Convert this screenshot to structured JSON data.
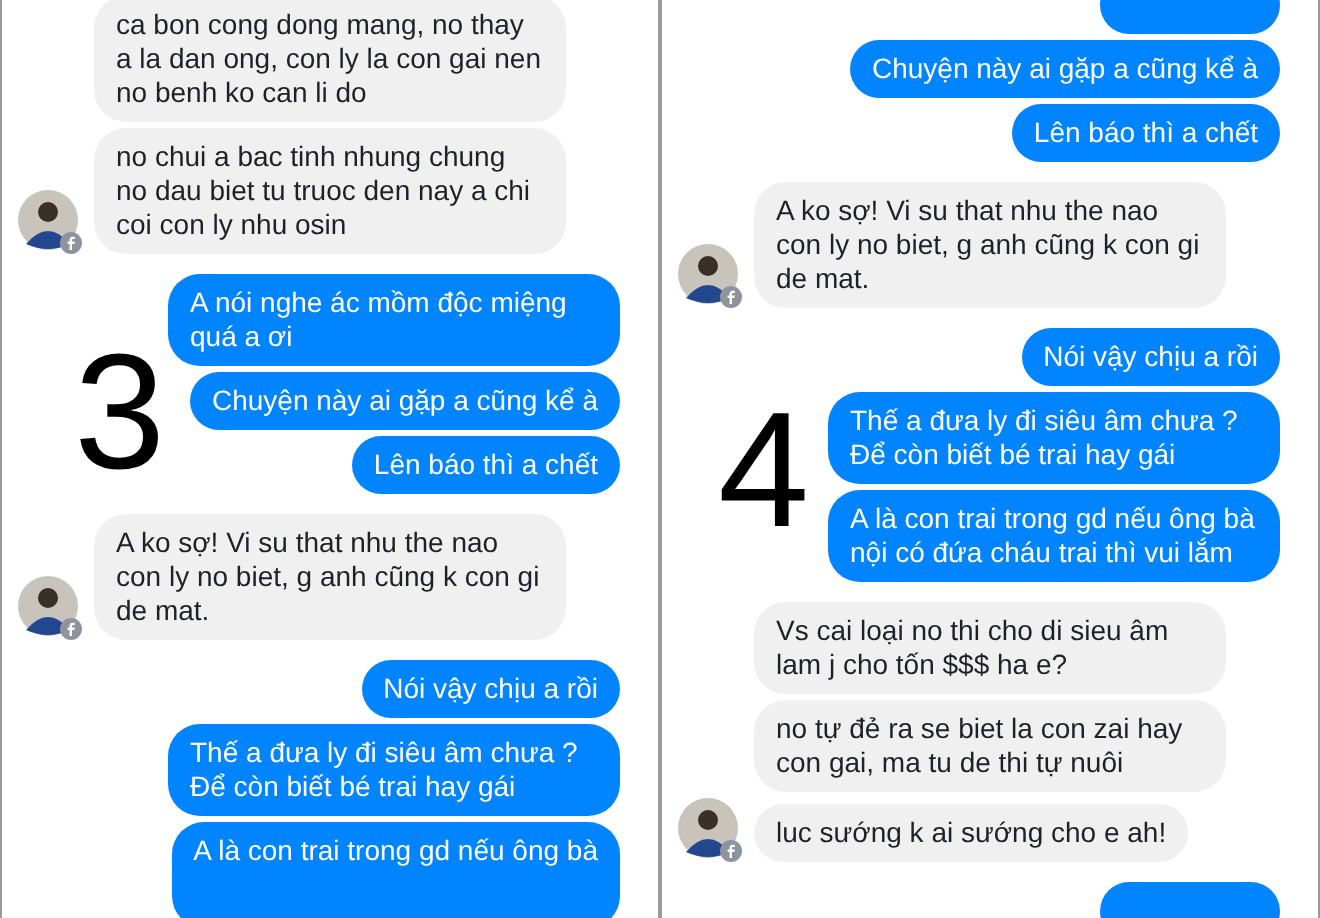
{
  "panels": [
    {
      "number": "3",
      "messages": [
        {
          "kind": "received",
          "text": "ca bon cong dong mang, no thay a la dan ong, con ly la con gai nen no benh ko can li do",
          "avatar": false
        },
        {
          "kind": "received",
          "text": "no chui a bac tinh nhung chung no dau biet tu truoc den nay a chi coi con ly nhu osin",
          "avatar": true
        },
        {
          "kind": "sent",
          "text": "A nói nghe ác mồm độc miệng quá a ơi"
        },
        {
          "kind": "sent",
          "text": "Chuyện này ai gặp a cũng kể à"
        },
        {
          "kind": "sent",
          "text": "Lên báo thì a chết"
        },
        {
          "kind": "received",
          "text": "A ko sợ! Vi su that nhu the nao con ly no biet, g anh cũng k con gi de mat.",
          "avatar": true
        },
        {
          "kind": "sent",
          "text": "Nói vậy chịu a rồi"
        },
        {
          "kind": "sent",
          "text": "Thế a đưa ly đi siêu âm chưa ? Để còn biết bé trai hay gái"
        },
        {
          "kind": "sent",
          "text": "A là con trai trong gd nếu ông bà"
        }
      ]
    },
    {
      "number": "4",
      "messages": [
        {
          "kind": "sent"
        },
        {
          "kind": "sent",
          "text": "Chuyện này ai gặp a cũng kể à"
        },
        {
          "kind": "sent",
          "text": "Lên báo thì a chết"
        },
        {
          "kind": "received",
          "text": "A ko sợ! Vi su that nhu the nao con ly no biet, g anh cũng k con gi de mat.",
          "avatar": true
        },
        {
          "kind": "sent",
          "text": "Nói vậy chịu a rồi"
        },
        {
          "kind": "sent",
          "text": "Thế a đưa ly đi siêu âm chưa ? Để còn biết bé trai hay gái"
        },
        {
          "kind": "sent",
          "text": "A là con trai trong gd nếu ông bà nội có đứa cháu trai thì vui lắm"
        },
        {
          "kind": "received",
          "text": "Vs cai loại no thi cho di sieu âm lam j cho tốn $$$ ha e?",
          "avatar": false
        },
        {
          "kind": "received",
          "text": "no tự đẻ ra se biet la con zai hay con gai, ma tu de thi tự nuôi",
          "avatar": false
        },
        {
          "kind": "received",
          "text": "luc sướng k ai sướng cho e ah!",
          "avatar": true
        },
        {
          "kind": "sent"
        }
      ]
    }
  ]
}
